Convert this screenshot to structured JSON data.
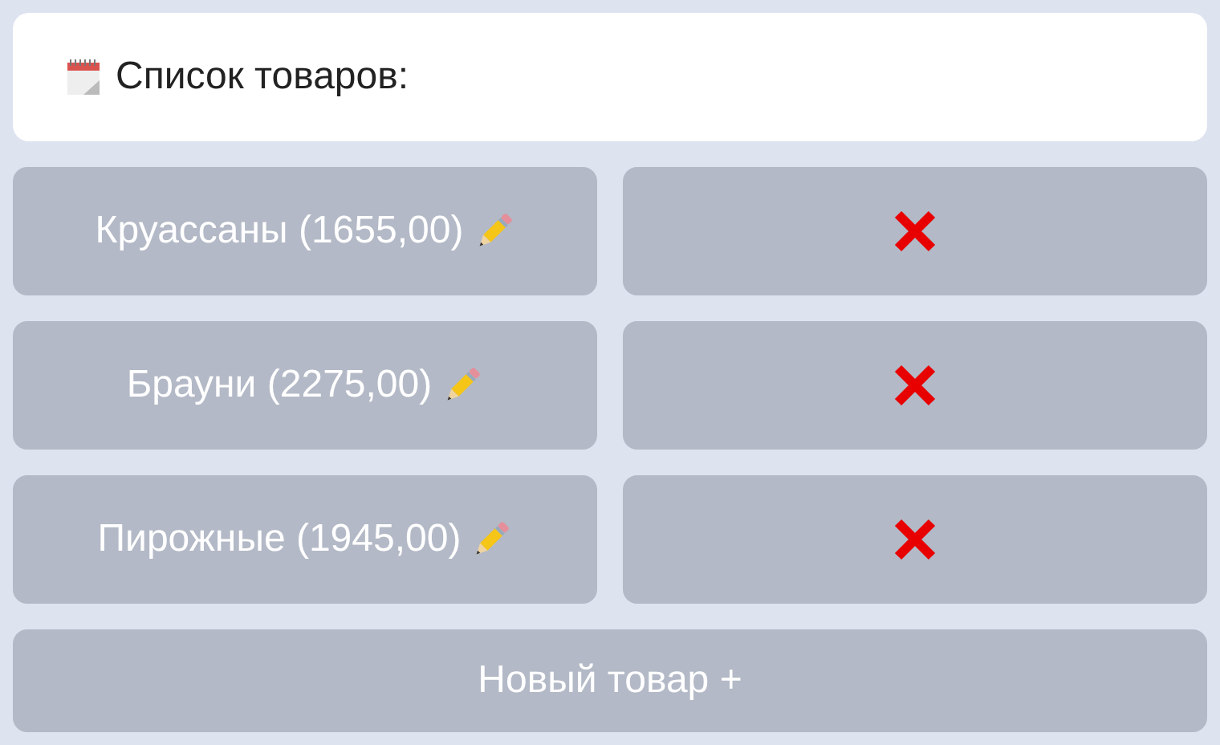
{
  "message": {
    "text": "Список товаров:"
  },
  "products": [
    {
      "label": "Круассаны (1655,00)"
    },
    {
      "label": "Брауни (2275,00)"
    },
    {
      "label": "Пирожные (1945,00)"
    }
  ],
  "new_button": {
    "label": "Новый товар +"
  }
}
